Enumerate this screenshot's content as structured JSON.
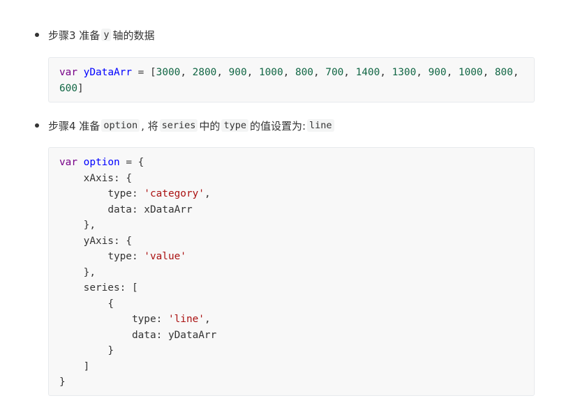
{
  "step3": {
    "text_before": "步骤3 准备",
    "code_y": "y",
    "text_after": "轴的数据"
  },
  "code1": {
    "kw_var": "var",
    "name": "yDataArr",
    "op": "=",
    "bracket_open": "[",
    "line1_values": [
      "3000",
      "2800",
      "900",
      "1000",
      "800",
      "700",
      "1400",
      "1300",
      "900",
      "1000",
      "800"
    ],
    "line2_value": "600",
    "bracket_close": "]"
  },
  "step4": {
    "text_before": "步骤4 准备",
    "code_option": "option",
    "text_mid1": ", 将",
    "code_series": "series",
    "text_mid2": "中的",
    "code_type": "type",
    "text_mid3": "的值设置为:",
    "code_line": "line"
  },
  "code2": {
    "kw_var": "var",
    "name": "option",
    "op": "=",
    "brace_open": "{",
    "xaxis_key": "xAxis",
    "type_key": "type",
    "type_category": "'category'",
    "data_key": "data",
    "xdata_value": "xDataArr",
    "yaxis_key": "yAxis",
    "type_value": "'value'",
    "series_key": "series",
    "type_line": "'line'",
    "ydata_value": "yDataArr",
    "brace_close": "}",
    "bracket_open": "[",
    "bracket_close": "]"
  }
}
